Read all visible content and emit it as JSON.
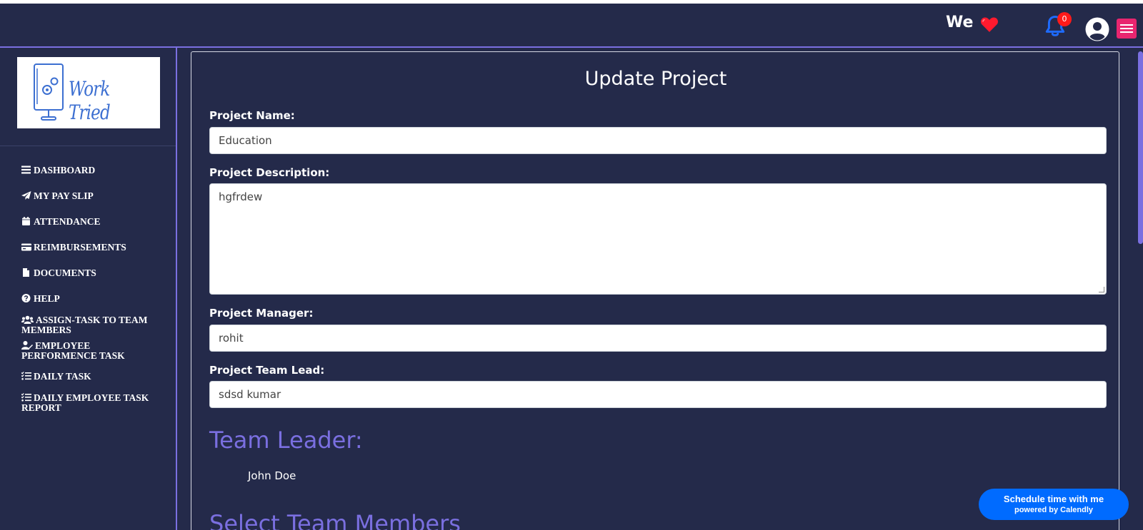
{
  "header": {
    "we_text": "We",
    "notification_count": "0",
    "colors": {
      "background": "#242a4a",
      "heart": "#ff1a2e",
      "bell": "#1e6bff",
      "badge": "#ff1a1a",
      "menu": "#e8256f"
    }
  },
  "sidebar": {
    "logo_text": "Work Tried",
    "items": [
      {
        "label": "DASHBOARD",
        "icon": "bars-icon"
      },
      {
        "label": "MY PAY SLIP",
        "icon": "paper-plane-icon"
      },
      {
        "label": "ATTENDANCE",
        "icon": "calendar-icon"
      },
      {
        "label": "REIMBURSEMENTS",
        "icon": "credit-card-icon"
      },
      {
        "label": "DOCUMENTS",
        "icon": "file-icon"
      },
      {
        "label": "HELP",
        "icon": "question-circle-icon"
      },
      {
        "label": "ASSIGN-TASK TO TEAM MEMBERS",
        "icon": "users-icon"
      },
      {
        "label": "EMPLOYEE PERFORMENCE TASK",
        "icon": "user-edit-icon"
      },
      {
        "label": "DAILY TASK",
        "icon": "list-check-icon"
      },
      {
        "label": "DAILY EMPLOYEE TASK REPORT",
        "icon": "list-check-icon"
      }
    ]
  },
  "form": {
    "title": "Update Project",
    "project_name_label": "Project Name:",
    "project_name_value": "Education",
    "project_description_label": "Project Description:",
    "project_description_value": "hgfrdew",
    "project_manager_label": "Project Manager:",
    "project_manager_value": "rohit",
    "project_team_lead_label": "Project Team Lead:",
    "project_team_lead_value": "sdsd kumar",
    "team_leader_heading": "Team Leader:",
    "team_leader_name": "John Doe",
    "select_team_members_heading": "Select Team Members"
  },
  "calendly": {
    "line1": "Schedule time with me",
    "line2": "powered by Calendly",
    "color": "#006bff"
  }
}
